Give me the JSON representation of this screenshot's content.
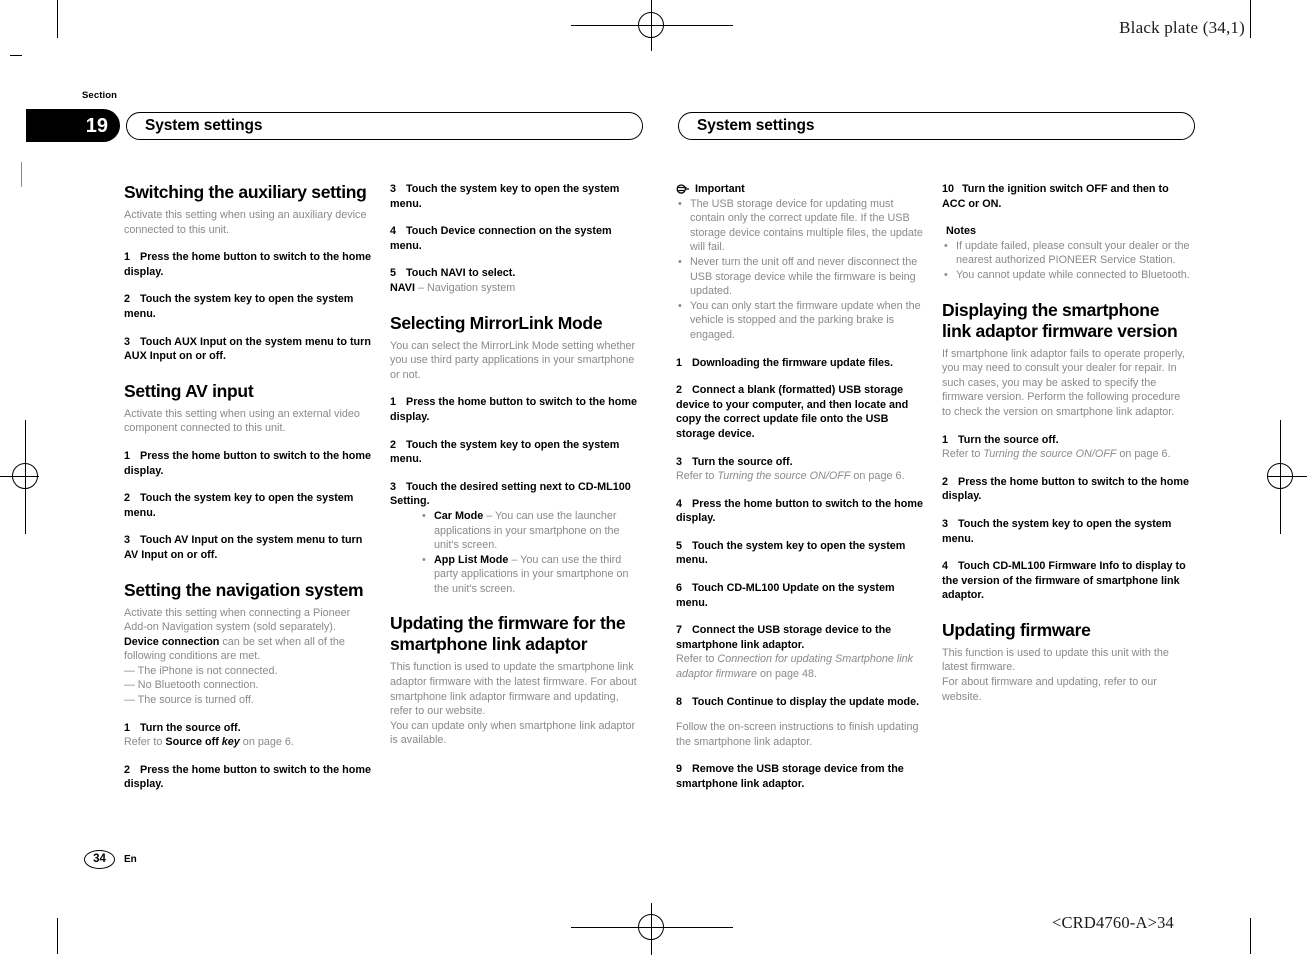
{
  "print_marks": {
    "black_plate": "Black plate (34,1)",
    "doc_id": "<CRD4760-A>34"
  },
  "section": {
    "label": "Section",
    "number": "19"
  },
  "headers": {
    "left": "System settings",
    "right": "System settings"
  },
  "footer": {
    "page_number": "34",
    "language": "En"
  },
  "columns": {
    "col1": [
      {
        "kind": "heading",
        "text": "Switching the auxiliary setting"
      },
      {
        "kind": "intro",
        "text": "Activate this setting when using an auxiliary device connected to this unit."
      },
      {
        "kind": "step",
        "num": "1",
        "text": "Press the home button to switch to the home display."
      },
      {
        "kind": "step",
        "num": "2",
        "text": "Touch the system key to open the system menu."
      },
      {
        "kind": "step",
        "num": "3",
        "text": "Touch AUX Input on the system menu to turn AUX Input on or off."
      },
      {
        "kind": "heading",
        "text": "Setting AV input"
      },
      {
        "kind": "intro",
        "text": "Activate this setting when using an external video component connected to this unit."
      },
      {
        "kind": "step",
        "num": "1",
        "text": "Press the home button to switch to the home display."
      },
      {
        "kind": "step",
        "num": "2",
        "text": "Touch the system key to open the system menu."
      },
      {
        "kind": "step",
        "num": "3",
        "text": "Touch AV Input on the system menu to turn AV Input on or off."
      },
      {
        "kind": "heading",
        "text": "Setting the navigation system"
      },
      {
        "kind": "intro_rich",
        "parts": [
          {
            "t": "Activate this setting when connecting a Pioneer Add-on Navigation system (sold separately). ",
            "b": false
          },
          {
            "t": "Device connection",
            "b": true
          },
          {
            "t": " can be set when all of the following conditions are met.",
            "b": false
          }
        ]
      },
      {
        "kind": "dashlist",
        "items": [
          "— The iPhone is not connected.",
          "— No Bluetooth connection.",
          "— The source is turned off."
        ]
      },
      {
        "kind": "step",
        "num": "1",
        "text": "Turn the source off."
      },
      {
        "kind": "sub_ref",
        "pre": "Refer to ",
        "ref": "Source off key",
        "post": " on page 6.",
        "ref_style": "bold-italic-mix"
      },
      {
        "kind": "step",
        "num": "2",
        "text": "Press the home button to switch to the home display."
      }
    ],
    "col2": [
      {
        "kind": "step",
        "num": "3",
        "text": "Touch the system key to open the system menu."
      },
      {
        "kind": "step",
        "num": "4",
        "text": "Touch Device connection on the system menu."
      },
      {
        "kind": "step",
        "num": "5",
        "text": "Touch NAVI to select."
      },
      {
        "kind": "sub_bold_lead",
        "bold": "NAVI",
        "rest": " – Navigation system"
      },
      {
        "kind": "heading",
        "text": "Selecting MirrorLink Mode"
      },
      {
        "kind": "intro",
        "text": "You can select the MirrorLink Mode setting whether you use third party applications in your smartphone or not."
      },
      {
        "kind": "step",
        "num": "1",
        "text": "Press the home button to switch to the home display."
      },
      {
        "kind": "step",
        "num": "2",
        "text": "Touch the system key to open the system menu."
      },
      {
        "kind": "step",
        "num": "3",
        "text": "Touch the desired setting next to CD-ML100 Setting."
      },
      {
        "kind": "bullets_indented",
        "items": [
          {
            "bold": "Car Mode",
            "rest": " – You can use the launcher applications in your smartphone on the unit's screen."
          },
          {
            "bold": "App List Mode",
            "rest": " – You can use the third party applications in your smartphone on the unit's screen."
          }
        ]
      },
      {
        "kind": "heading",
        "text": "Updating the firmware for the smartphone link adaptor"
      },
      {
        "kind": "intro",
        "text": "This function is used to update the smartphone link adaptor firmware with the latest firmware. For about smartphone link adaptor firmware and updating, refer to our website."
      },
      {
        "kind": "intro",
        "text": "You can update only when smartphone link adaptor is available."
      }
    ],
    "col3": [
      {
        "kind": "important_head",
        "text": "Important",
        "icon": "important-icon"
      },
      {
        "kind": "bullets",
        "items": [
          {
            "bold": "",
            "rest": "The USB storage device for updating must contain only the correct update file. If the USB storage device contains multiple files, the update will fail."
          },
          {
            "bold": "",
            "rest": "Never turn the unit off and never disconnect the USB storage device while the firmware is being updated."
          },
          {
            "bold": "",
            "rest": "You can only start the firmware update when the vehicle is stopped and the parking brake is engaged."
          }
        ]
      },
      {
        "kind": "step",
        "num": "1",
        "text": "Downloading the firmware update files."
      },
      {
        "kind": "step",
        "num": "2",
        "text": "Connect a blank (formatted) USB storage device to your computer, and then locate and copy the correct update file onto the USB storage device."
      },
      {
        "kind": "step",
        "num": "3",
        "text": "Turn the source off."
      },
      {
        "kind": "sub_ref",
        "pre": "Refer to ",
        "ref": "Turning the source ON/OFF",
        "post": " on page 6."
      },
      {
        "kind": "step",
        "num": "4",
        "text": "Press the home button to switch to the home display."
      },
      {
        "kind": "step",
        "num": "5",
        "text": "Touch the system key to open the system menu."
      },
      {
        "kind": "step",
        "num": "6",
        "text": "Touch CD-ML100 Update on the system menu."
      },
      {
        "kind": "step",
        "num": "7",
        "text": "Connect the USB storage device to the smartphone link adaptor."
      },
      {
        "kind": "sub_ref",
        "pre": "Refer to ",
        "ref": "Connection for updating Smartphone link adaptor firmware",
        "post": " on page 48."
      },
      {
        "kind": "step",
        "num": "8",
        "text": "Touch Continue to display the update mode."
      },
      {
        "kind": "intro",
        "text": "Follow the on-screen instructions to finish updating the smartphone link adaptor."
      },
      {
        "kind": "step",
        "num": "9",
        "text": "Remove the USB storage device from the smartphone link adaptor."
      }
    ],
    "col4": [
      {
        "kind": "step",
        "num": "10",
        "wide": true,
        "text": "Turn the ignition switch OFF and then to ACC or ON."
      },
      {
        "kind": "note_head",
        "text": "Notes"
      },
      {
        "kind": "bullets",
        "items": [
          {
            "bold": "",
            "rest": "If update failed, please consult your dealer or the nearest authorized PIONEER Service Station."
          },
          {
            "bold": "",
            "rest": "You cannot update while connected to Bluetooth."
          }
        ]
      },
      {
        "kind": "heading",
        "text": "Displaying the smartphone link adaptor firmware version"
      },
      {
        "kind": "intro",
        "text": "If smartphone link adaptor fails to operate properly, you may need to consult your dealer for repair. In such cases, you may be asked to specify the firmware version. Perform the following procedure to check the version on smartphone link adaptor."
      },
      {
        "kind": "step",
        "num": "1",
        "text": "Turn the source off."
      },
      {
        "kind": "sub_ref",
        "pre": "Refer to ",
        "ref": "Turning the source ON/OFF",
        "post": " on page 6."
      },
      {
        "kind": "step",
        "num": "2",
        "text": "Press the home button to switch to the home display."
      },
      {
        "kind": "step",
        "num": "3",
        "text": "Touch the system key to open the system menu."
      },
      {
        "kind": "step",
        "num": "4",
        "text": "Touch CD-ML100 Firmware Info to display to the version of the firmware of smartphone link adaptor."
      },
      {
        "kind": "heading",
        "text": "Updating firmware"
      },
      {
        "kind": "intro",
        "text": "This function is used to update this unit with the latest firmware."
      },
      {
        "kind": "intro",
        "text": "For about firmware and updating, refer to our website."
      }
    ]
  }
}
